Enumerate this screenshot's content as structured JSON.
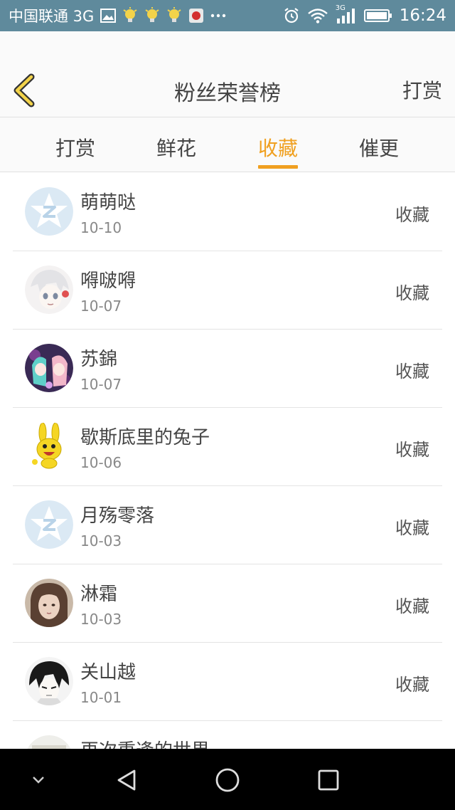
{
  "status_bar": {
    "carrier": "中国联通 3G",
    "network_tag": "3G",
    "time": "16:24",
    "notification_icons": [
      "image-icon",
      "bulb-icon",
      "bulb-icon",
      "bulb-icon",
      "huawei-app-icon",
      "more-dots-icon"
    ],
    "right_icons": [
      "alarm-icon",
      "wifi-icon",
      "signal-icon",
      "battery-icon"
    ]
  },
  "header": {
    "title": "粉丝荣誉榜",
    "action_label": "打赏",
    "back_icon": "chevron-left-icon",
    "accent_color": "#f0a020"
  },
  "tabs": [
    {
      "label": "打赏",
      "active": false
    },
    {
      "label": "鲜花",
      "active": false
    },
    {
      "label": "收藏",
      "active": true
    },
    {
      "label": "催更",
      "active": false
    }
  ],
  "list": [
    {
      "name": "萌萌哒",
      "date": "10-10",
      "action": "收藏",
      "avatar": "default-qz-avatar"
    },
    {
      "name": "嘚啵嘚",
      "date": "10-07",
      "action": "收藏",
      "avatar": "anime-white-hair-avatar"
    },
    {
      "name": "苏錦",
      "date": "10-07",
      "action": "收藏",
      "avatar": "anime-twins-avatar"
    },
    {
      "name": "歇斯底里的兔子",
      "date": "10-06",
      "action": "收藏",
      "avatar": "yellow-rabbit-avatar"
    },
    {
      "name": "月殇零落",
      "date": "10-03",
      "action": "收藏",
      "avatar": "default-qz-avatar"
    },
    {
      "name": "淋霜",
      "date": "10-03",
      "action": "收藏",
      "avatar": "girl-photo-avatar"
    },
    {
      "name": "关山越",
      "date": "10-01",
      "action": "收藏",
      "avatar": "anime-black-hair-avatar"
    },
    {
      "name": "再次重逢的世界",
      "date": "",
      "action": "",
      "avatar": "partial-avatar"
    }
  ],
  "navbar": {
    "icons": [
      "chevron-down-icon",
      "back-triangle-icon",
      "home-circle-icon",
      "recents-square-icon"
    ]
  }
}
